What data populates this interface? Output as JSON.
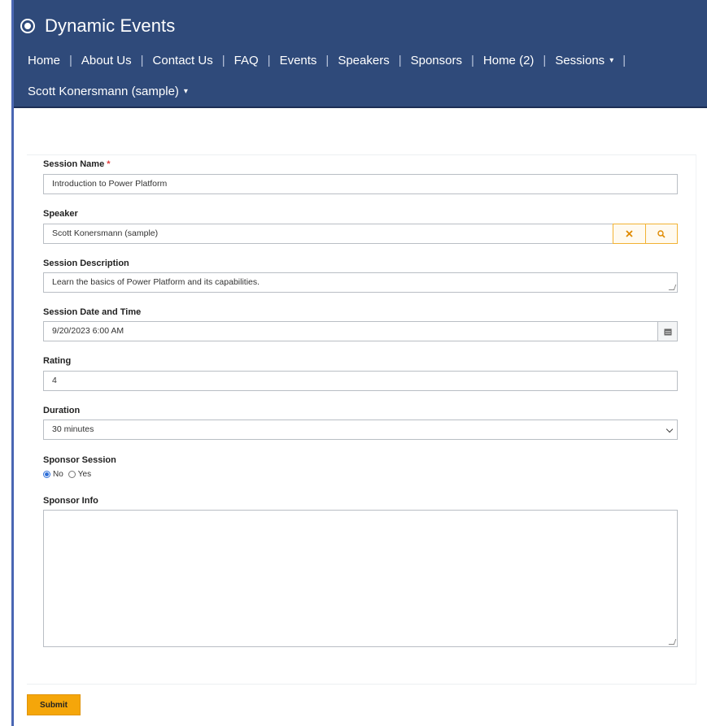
{
  "header": {
    "brand": "Dynamic Events",
    "nav": [
      {
        "label": "Home"
      },
      {
        "label": "About Us"
      },
      {
        "label": "Contact Us"
      },
      {
        "label": "FAQ"
      },
      {
        "label": "Events"
      },
      {
        "label": "Speakers"
      },
      {
        "label": "Sponsors"
      },
      {
        "label": "Home (2)"
      },
      {
        "label": "Sessions"
      }
    ],
    "user_menu": "Scott Konersmann (sample)"
  },
  "form": {
    "session_name": {
      "label": "Session Name",
      "required_mark": "*",
      "value": "Introduction to Power Platform"
    },
    "speaker": {
      "label": "Speaker",
      "value": "Scott Konersmann (sample)"
    },
    "session_description": {
      "label": "Session Description",
      "value": "Learn the basics of Power Platform and its capabilities."
    },
    "session_datetime": {
      "label": "Session Date and Time",
      "value": "9/20/2023 6:00 AM"
    },
    "rating": {
      "label": "Rating",
      "value": "4"
    },
    "duration": {
      "label": "Duration",
      "value": "30 minutes"
    },
    "sponsor_session": {
      "label": "Sponsor Session",
      "options": [
        "No",
        "Yes"
      ],
      "selected": "No"
    },
    "sponsor_info": {
      "label": "Sponsor Info",
      "value": ""
    },
    "submit_label": "Submit"
  },
  "colors": {
    "header_bg": "#2f4a7a",
    "accent": "#f5a60a",
    "radio": "#2f6fd8",
    "required": "#e03c3c"
  },
  "icons": {
    "brand": "radio-dot-icon",
    "clear": "x-icon",
    "search": "search-icon",
    "calendar": "calendar-icon"
  }
}
